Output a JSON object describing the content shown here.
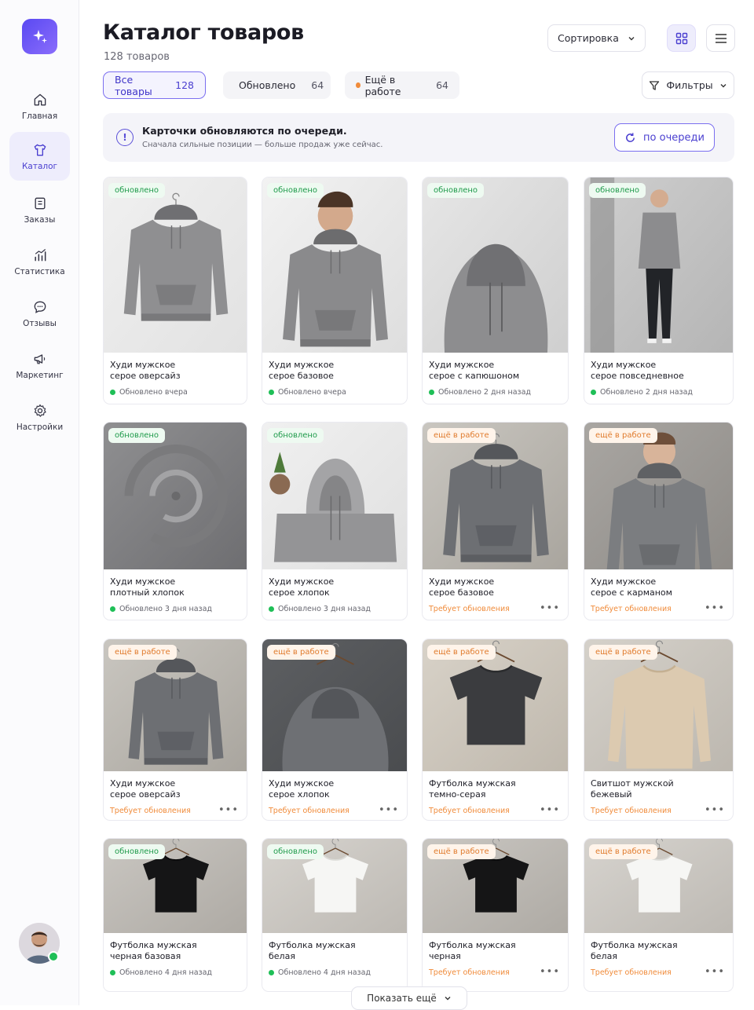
{
  "nav": [
    {
      "label": "Главная",
      "icon": "home-icon"
    },
    {
      "label": "Каталог",
      "icon": "tshirt-icon"
    },
    {
      "label": "Заказы",
      "icon": "orders-icon"
    },
    {
      "label": "Статистика",
      "icon": "stats-icon"
    },
    {
      "label": "Отзывы",
      "icon": "chat-icon"
    },
    {
      "label": "Маркетинг",
      "icon": "megaphone-icon"
    },
    {
      "label": "Настройки",
      "icon": "gear-icon"
    }
  ],
  "header": {
    "title": "Каталог товаров",
    "count": "128 товаров",
    "sort_label": "Сортировка"
  },
  "chips": {
    "all": {
      "label": "Все товары",
      "count": "128"
    },
    "updated": {
      "label": "Обновлено",
      "count": "64"
    },
    "in_progress": {
      "label": "Ещё в работе",
      "count": "64"
    }
  },
  "filters_label": "Фильтры",
  "banner": {
    "title": "Карточки обновляются по очереди.",
    "subtitle": "Сначала сильные позиции — больше продаж уже сейчас.",
    "button": "по очереди"
  },
  "colors": {
    "accent": "#5a4fd8",
    "green": "#1fbf57",
    "orange": "#f08b3a"
  },
  "products": [
    {
      "badge": "обновлено",
      "name1": "Худи мужское",
      "name2": "серое оверсайз",
      "status": "Обновлено вчера",
      "updated": true,
      "img": "hoodie"
    },
    {
      "badge": "обновлено",
      "name1": "Худи мужское",
      "name2": "серое базовое",
      "status": "Обновлено вчера",
      "updated": true,
      "img": "model"
    },
    {
      "badge": "обновлено",
      "name1": "Худи мужское",
      "name2": "серое с капюшоном",
      "status": "Обновлено 2 дня назад",
      "updated": true,
      "img": "hood"
    },
    {
      "badge": "обновлено",
      "name1": "Худи мужское",
      "name2": "серое повседневное",
      "status": "Обновлено 2 дня назад",
      "updated": true,
      "img": "fullbody"
    },
    {
      "badge": "обновлено",
      "name1": "Худи мужское",
      "name2": "плотный хлопок",
      "status": "Обновлено 3 дня назад",
      "updated": true,
      "img": "fabric"
    },
    {
      "badge": "обновлено",
      "name1": "Худи мужское",
      "name2": "серое хлопок",
      "status": "Обновлено 3 дня назад",
      "updated": true,
      "img": "folded"
    },
    {
      "badge": "ещё в работе",
      "name1": "Худи мужское",
      "name2": "серое базовое",
      "status": "Требует обновления",
      "updated": false,
      "img": "hoodie-dark"
    },
    {
      "badge": "ещё в работе",
      "name1": "Худи мужское",
      "name2": "серое с карманом",
      "status": "Требует обновления",
      "updated": false,
      "img": "model-wall"
    },
    {
      "badge": "ещё в работе",
      "name1": "Худи мужское",
      "name2": "серое оверсайз",
      "status": "Требует обновления",
      "updated": false,
      "img": "hoodie-dark"
    },
    {
      "badge": "ещё в работе",
      "name1": "Худи мужское",
      "name2": "серое хлопок",
      "status": "Требует обновления",
      "updated": false,
      "img": "hood-dark"
    },
    {
      "badge": "ещё в работе",
      "name1": "Футболка мужская",
      "name2": "темно-серая",
      "status": "Требует обновления",
      "updated": false,
      "img": "tee-dark"
    },
    {
      "badge": "ещё в работе",
      "name1": "Свитшот мужской",
      "name2": "бежевый",
      "status": "Требует обновления",
      "updated": false,
      "img": "sweat-beige"
    },
    {
      "badge": "обновлено",
      "name1": "Футболка мужская",
      "name2": "черная базовая",
      "status": "Обновлено 4 дня назад",
      "updated": true,
      "img": "tee-black"
    },
    {
      "badge": "обновлено",
      "name1": "Футболка мужская",
      "name2": "белая",
      "status": "Обновлено 4 дня назад",
      "updated": true,
      "img": "tee-white"
    },
    {
      "badge": "ещё в работе",
      "name1": "Футболка мужская",
      "name2": "черная",
      "status": "Требует обновления",
      "updated": false,
      "img": "tee-black"
    },
    {
      "badge": "ещё в работе",
      "name1": "Футболка мужская",
      "name2": "белая",
      "status": "Требует обновления",
      "updated": false,
      "img": "tee-white"
    }
  ],
  "more_glyph": "•••",
  "show_more": "Показать ещё"
}
